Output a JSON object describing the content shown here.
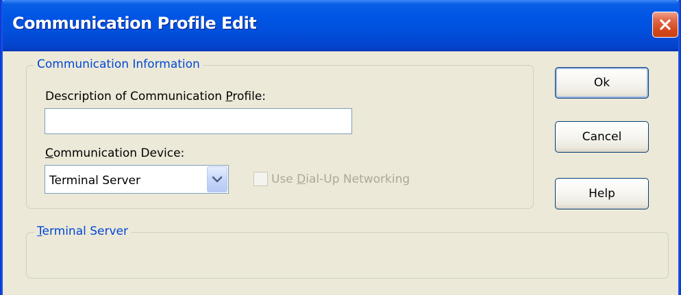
{
  "window": {
    "title": "Communication Profile Edit",
    "close_icon": "close-icon"
  },
  "communication_info": {
    "legend": "Communication Information",
    "description_label_pre": "Description of Communication ",
    "description_label_accel": "P",
    "description_label_post": "rofile:",
    "description_value": "",
    "device_label_accel": "C",
    "device_label_post": "ommunication Device:",
    "device_selected": "Terminal Server",
    "dialup_pre": "Use ",
    "dialup_accel": "D",
    "dialup_post": "ial-Up Networking",
    "dialup_checked": false
  },
  "terminal_server": {
    "legend_accel": "T",
    "legend_post": "erminal Server"
  },
  "buttons": {
    "ok": "Ok",
    "cancel": "Cancel",
    "help": "Help"
  },
  "colors": {
    "titlebar": "#0054e3",
    "dialog_bg": "#ece9d8",
    "legend_text": "#0046d5",
    "close_button": "#d4491e",
    "disabled_text": "#aca899"
  }
}
